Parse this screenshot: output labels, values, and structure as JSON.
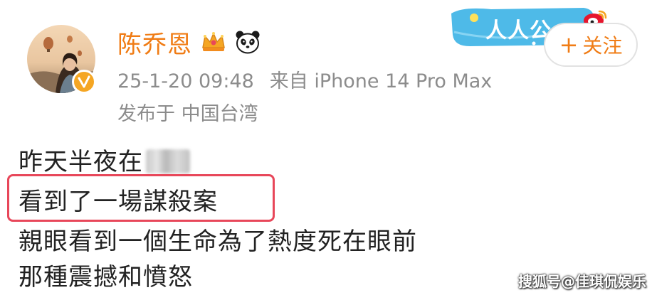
{
  "post": {
    "username": "陈乔恩",
    "badges": [
      "crown-badge-icon",
      "panda-icon"
    ],
    "timestamp": "25-1-20 09:48",
    "device": "来自 iPhone 14 Pro Max",
    "region": "发布于 中国台湾",
    "follow_label": "关注",
    "follow_plus": "+",
    "lines": [
      "昨天半夜在",
      "看到了一場謀殺案",
      "親眼看到一個生命為了熱度死在眼前",
      "那種震撼和憤怒"
    ],
    "highlight_color": "#e8475a"
  },
  "watermarks": {
    "banner_text": "人人公",
    "source": "搜狐号@佳琪侃娱乐"
  },
  "colors": {
    "username": "#f07c15",
    "meta": "#8c8c8c",
    "verified_badge": "#f5a623",
    "banner": "#3bb3e6"
  }
}
